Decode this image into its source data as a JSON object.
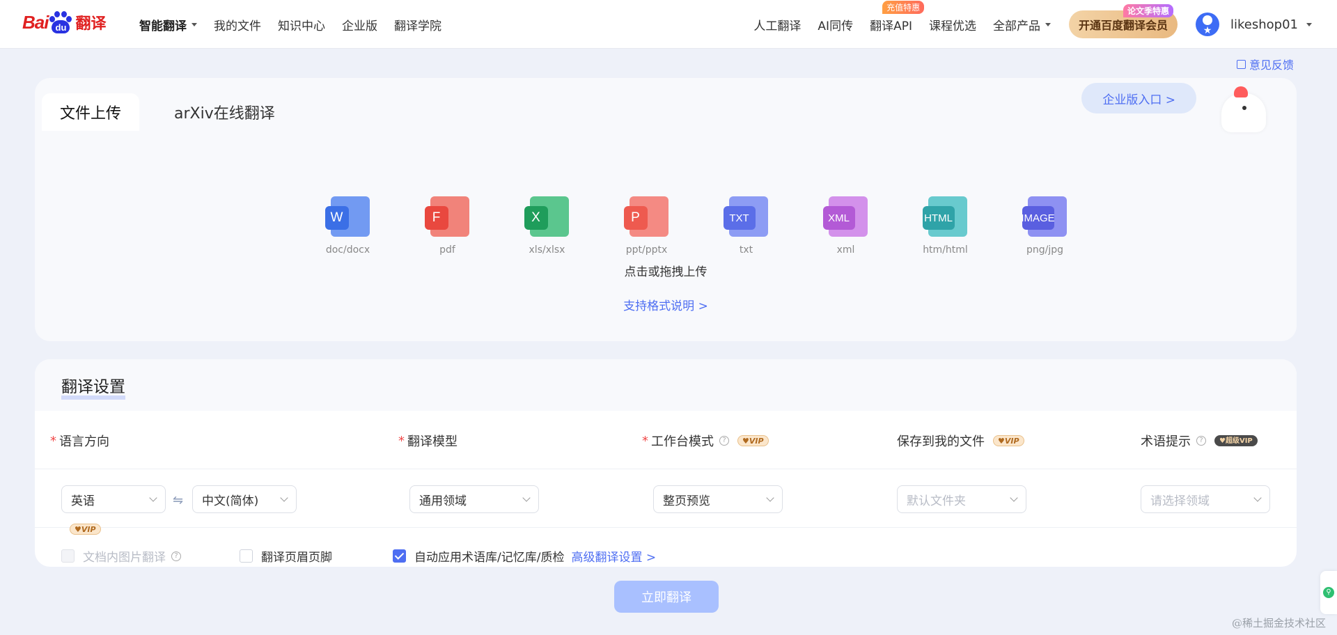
{
  "header": {
    "logo": {
      "part1": "Bai",
      "paw_text": "du",
      "part2": "翻译"
    },
    "nav": [
      {
        "label": "智能翻译",
        "active": true,
        "dropdown": true
      },
      {
        "label": "我的文件"
      },
      {
        "label": "知识中心"
      },
      {
        "label": "企业版"
      },
      {
        "label": "翻译学院"
      }
    ],
    "right_nav": [
      {
        "label": "人工翻译"
      },
      {
        "label": "AI同传"
      },
      {
        "label": "翻译API",
        "badge": "充值特惠"
      },
      {
        "label": "课程优选"
      },
      {
        "label": "全部产品",
        "dropdown": true
      }
    ],
    "vip_button": {
      "label": "开通百度翻译会员",
      "badge": "论文季特惠"
    },
    "user": {
      "name": "likeshop01"
    }
  },
  "feedback": {
    "label": "意见反馈"
  },
  "upload": {
    "tabs": [
      "文件上传",
      "arXiv在线翻译"
    ],
    "enterprise_entry": "企业版入口 >",
    "file_types": [
      {
        "label": "doc/docx",
        "icon": "word-icon",
        "glyph": "W",
        "color": "#3b6fe6",
        "back": "#5b8af0"
      },
      {
        "label": "pdf",
        "icon": "pdf-icon",
        "glyph": "F",
        "color": "#e9483f",
        "back": "#f06e63"
      },
      {
        "label": "xls/xlsx",
        "icon": "excel-icon",
        "glyph": "X",
        "color": "#1f9d5b",
        "back": "#3fbd7a"
      },
      {
        "label": "ppt/pptx",
        "icon": "powerpoint-icon",
        "glyph": "P",
        "color": "#ee5a4f",
        "back": "#f3776d"
      },
      {
        "label": "txt",
        "icon": "txt-icon",
        "glyph": "TXT",
        "color": "#5b6ee8",
        "back": "#7a8cf2"
      },
      {
        "label": "xml",
        "icon": "xml-icon",
        "glyph": "XML",
        "color": "#b35ad6",
        "back": "#cd7fe8"
      },
      {
        "label": "htm/html",
        "icon": "html-icon",
        "glyph": "HTML",
        "color": "#2fa3a8",
        "back": "#4fc2c6"
      },
      {
        "label": "png/jpg",
        "icon": "image-icon",
        "glyph": "IMAGE",
        "color": "#5a5fe0",
        "back": "#7b7ff0"
      }
    ],
    "drop_hint": "点击或拖拽上传",
    "format_link": "支持格式说明 >"
  },
  "settings": {
    "title": "翻译设置",
    "columns": {
      "language": {
        "label": "语言方向",
        "required": true
      },
      "model": {
        "label": "翻译模型",
        "required": true
      },
      "workbench": {
        "label": "工作台模式",
        "required": true,
        "vip": "VIP"
      },
      "save": {
        "label": "保存到我的文件",
        "vip": "VIP"
      },
      "term": {
        "label": "术语提示",
        "vip": "超级VIP"
      }
    },
    "selects": {
      "source_lang": "英语",
      "target_lang": "中文(简体)",
      "swap_glyph": "⇋",
      "model": "通用领域",
      "workbench": "整页预览",
      "save_placeholder": "默认文件夹",
      "term_placeholder": "请选择领域"
    },
    "options": {
      "vip_tag": "VIP",
      "image_translate": {
        "label": "文档内图片翻译",
        "checked": false,
        "disabled": true
      },
      "header_footer": {
        "label": "翻译页眉页脚",
        "checked": false
      },
      "auto_apply": {
        "label": "自动应用术语库/记忆库/质检",
        "checked": true
      },
      "advanced_link": "高级翻译设置 >"
    }
  },
  "translate_button": "立即翻译",
  "watermark": "@稀土掘金技术社区"
}
